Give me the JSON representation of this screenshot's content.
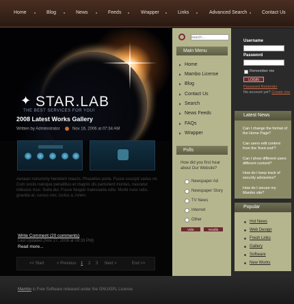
{
  "nav": [
    "Home",
    "Blog",
    "News",
    "Feeds",
    "Wrapper",
    "Links",
    "Advanced Search",
    "Contact Us"
  ],
  "hero": {
    "logo": "STAR.LAB",
    "tagline": "THE BEST SERVICES FOR YOU!"
  },
  "article": {
    "title": "2008 Latest Works Gallery",
    "author": "Written by Administrator",
    "date": "Nov 16, 2006 at 07:34 AM",
    "thumb1_label": "",
    "thumb2_label": "",
    "body": "Aenean nonummy hendrerit mauris. Phasellus porta. Fusce suscipit varius mi. Cum sociis natoque penatibus et magnis dis parturient montes, nascetur ridiculus mus. Nulla dui. Fusce feugiat malesuada odio. Morbi nunc odio, gravida at, cursus nec, luctus a, lorem.",
    "write_comment": "Write Comment (20 comments)",
    "last_updated": "Last Updated (Nov 27, 2008 at 08:33 PM)",
    "read_more": "Read more..."
  },
  "pager": {
    "start": "<< Start",
    "prev": "< Previous",
    "p1": "1",
    "p2": "2",
    "p3": "3",
    "next": "Next >",
    "end": "End >>"
  },
  "search": {
    "placeholder": "search..."
  },
  "main_menu": {
    "title": "Main Menu",
    "items": [
      "Home",
      "Mambo License",
      "Blog",
      "Contact Us",
      "Search",
      "News Feeds",
      "FAQs",
      "Wrapper"
    ]
  },
  "polls": {
    "title": "Polls",
    "question": "How did you first hear about Our Website?",
    "options": [
      "Newspaper Ad",
      "Newspaper Story",
      "TV News",
      "Internet",
      "Other"
    ],
    "vote": "vote",
    "results": "results"
  },
  "login": {
    "username": "Username",
    "password": "Password",
    "remember": "Remember me",
    "button": "LOGIN",
    "reminder": "Password Reminder",
    "no_account": "No account yet?",
    "create": "Create one"
  },
  "latest_news": {
    "title": "Latest News",
    "items": [
      "Can I change the format of the Home Page?",
      "Can users edit content from the 'front end'?",
      "Can I show different users different content?",
      "How do I keep track of security advisories?",
      "How do I secure my Mambo site?"
    ]
  },
  "popular": {
    "title": "Popular",
    "items": [
      "Hot News",
      "Web Design",
      "Fresh Links",
      "Gallery",
      "Software",
      "New Works"
    ]
  },
  "footer": {
    "link": "Mambo",
    "text": " is Free Software released under the GNU/GPL License."
  }
}
